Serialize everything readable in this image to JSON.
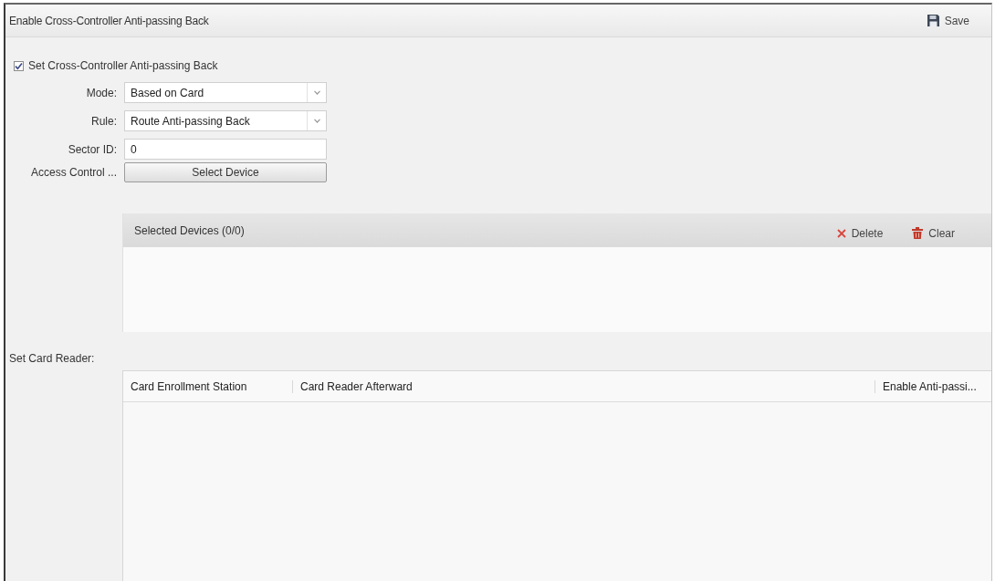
{
  "window": {
    "title": "Enable Cross-Controller Anti-passing Back",
    "save_button": "Save"
  },
  "enable_checkbox": {
    "label": "Set Cross-Controller Anti-passing Back",
    "checked": true
  },
  "fields": [
    {
      "kind": "select",
      "label": "Mode:",
      "value": "Based on Card"
    },
    {
      "kind": "select",
      "label": "Rule:",
      "value": "Route Anti-passing Back"
    },
    {
      "kind": "input",
      "label": "Sector ID:",
      "value": "0"
    },
    {
      "kind": "button",
      "label": "Access Control ...",
      "value": "Select Device"
    }
  ],
  "selected_devices": {
    "title": "Selected Devices (0/0)",
    "actions": [
      {
        "kind": "delete",
        "label": "Delete"
      },
      {
        "kind": "clear",
        "label": "Clear"
      }
    ]
  },
  "card_reader": {
    "label": "Set Card Reader:",
    "table": {
      "columns": [
        "Card Enrollment Station",
        "Card Reader Afterward",
        "Enable Anti-passi..."
      ]
    }
  }
}
